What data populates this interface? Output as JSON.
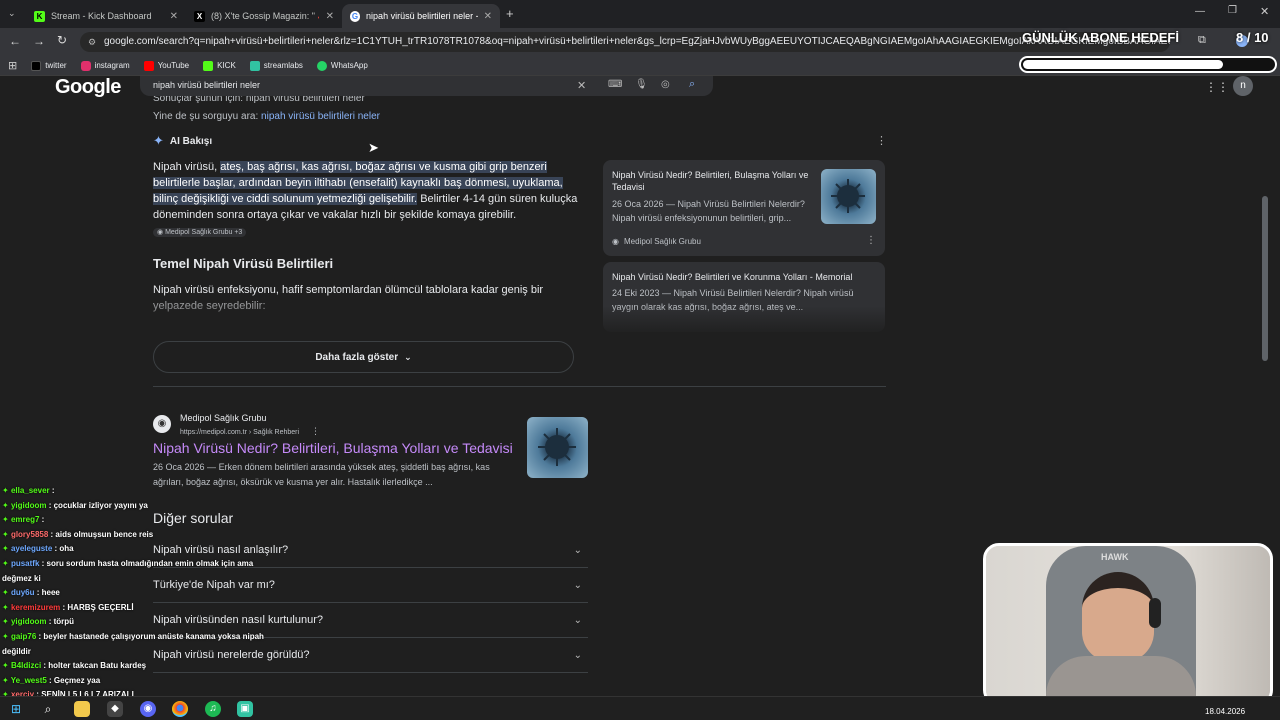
{
  "browser": {
    "tabs": [
      {
        "label": "Stream - Kick Dashboard"
      },
      {
        "label": "(8) X'te Gossip Magazin: \"🔺S"
      },
      {
        "label": "nipah virüsü belirtileri neler - G"
      }
    ],
    "url": "google.com/search?q=nipah+virüsü+belirtileri+neler&rlz=1C1YTUH_trTR1078TR1078&oq=nipah+virüsü+belirtileri+neler&gs_lcrp=EgZjaHJvbWUyBggAEEUYOTIJCAEQABgNGIAEMgoIAhAAGIAEGKIEMgoIAxAAGIAEGKIEMgoIBBAAGIAEGKIE",
    "bookmarks": [
      {
        "label": "twitter",
        "color": "#000000"
      },
      {
        "label": "instagram",
        "color": "#e1306c"
      },
      {
        "label": "YouTube",
        "color": "#ff0000"
      },
      {
        "label": "KICK",
        "color": "#53fc18"
      },
      {
        "label": "streamlabs",
        "color": "#31c3a2"
      },
      {
        "label": "WhatsApp",
        "color": "#25d366"
      }
    ]
  },
  "overlay": {
    "goal_label": "GÜNLÜK ABONE HEDEFİ",
    "goal_count": "8 / 10",
    "goal_progress": 0.8
  },
  "search": {
    "logo": "Google",
    "query": "nipah virüsü belirtileri neler",
    "related_cut": "Sonuçlar şunun için: nipah virüsü belirtileri neler",
    "search_instead_prefix": "Yine de şu sorguyu ara:",
    "search_instead_link": "nipah virüsü belirtileri neler"
  },
  "ai_overview": {
    "label": "AI Bakışı",
    "para_prefix": "Nipah virüsü,",
    "para_highlight": "ateş, baş ağrısı, kas ağrısı, boğaz ağrısı ve kusma gibi grip benzeri belirtilerle başlar, ardından beyin iltihabı (ensefalit) kaynaklı baş dönmesi, uyuklama, bilinç değişikliği ve ciddi solunum yetmezliği gelişebilir.",
    "para_rest": "Belirtiler 4-14 gün süren kuluçka döneminden sonra ortaya çıkar ve vakalar hızlı bir şekilde komaya girebilir.",
    "source_chip": "Medipol Sağlık Grubu +3",
    "heading": "Temel Nipah Virüsü Belirtileri",
    "heading_text": "Nipah virüsü enfeksiyonu, hafif semptomlardan ölümcül tablolara kadar geniş bir yelpazede seyredebilir:",
    "more_button": "Daha fazla göster",
    "sources": [
      {
        "title": "Nipah Virüsü Nedir? Belirtileri, Bulaşma Yolları ve Tedavisi",
        "snippet": "26 Oca 2026 — Nipah Virüsü Belirtileri Nelerdir? Nipah virüsü enfeksiyonunun belirtileri, grip...",
        "site": "Medipol Sağlık Grubu"
      },
      {
        "title": "Nipah Virüsü Nedir? Belirtileri ve Korunma Yolları - Memorial",
        "snippet": "24 Eki 2023 — Nipah Virüsü Belirtileri Nelerdir? Nipah virüsü yaygın olarak kas ağrısı, boğaz ağrısı, ateş ve..."
      }
    ]
  },
  "result": {
    "site": "Medipol Sağlık Grubu",
    "url": "https://medipol.com.tr › Sağlık Rehberi",
    "title": "Nipah Virüsü Nedir? Belirtileri, Bulaşma Yolları ve Tedavisi",
    "snippet_date": "26 Oca 2026 —",
    "snippet": "Erken dönem belirtileri arasında yüksek ateş, şiddetli baş ağrısı, kas ağrıları, boğaz ağrısı, öksürük ve kusma yer alır. Hastalık ilerledikçe ..."
  },
  "paa": {
    "heading": "Diğer sorular",
    "questions": [
      "Nipah virüsü nasıl anlaşılır?",
      "Türkiye'de Nipah var mı?",
      "Nipah virüsünden nasıl kurtulunur?",
      "Nipah virüsü nerelerde görüldü?"
    ]
  },
  "chat": [
    {
      "user": "ella_sever",
      "msg": ":",
      "color": "#53fc18"
    },
    {
      "user": "yigidoom",
      "msg": ": çocuklar izliyor yayını ya",
      "color": "#53fc18"
    },
    {
      "user": "emreg7",
      "msg": ":",
      "color": "#53fc18"
    },
    {
      "user": "glory5858",
      "msg": ": aids olmuşsun bence reis",
      "color": "#ff6b6b"
    },
    {
      "user": "ayeleguste",
      "msg": ": oha",
      "color": "#6ea8fe"
    },
    {
      "user": "pusatfk",
      "msg": ": soru sordum hasta olmadığından emin olmak için ama",
      "color": "#6ea8fe"
    },
    {
      "user": "",
      "msg": "değmez ki",
      "color": "#ffffff"
    },
    {
      "user": "duy6u",
      "msg": ": heee",
      "color": "#6ea8fe"
    },
    {
      "user": "keremizurem",
      "msg": ": HARBŞ GEÇERLİ",
      "color": "#ff3b3b"
    },
    {
      "user": "yigidoom",
      "msg": ": törpü",
      "color": "#53fc18"
    },
    {
      "user": "gaip76",
      "msg": ": beyler hastanede çalışıyorum anüste kanama yoksa nipah",
      "color": "#53fc18"
    },
    {
      "user": "",
      "msg": "değildir",
      "color": "#ffffff"
    },
    {
      "user": "B4ldizci",
      "msg": ": holter takcan Batu kardeş",
      "color": "#53fc18"
    },
    {
      "user": "Ye_west5",
      "msg": ": Geçmez yaa",
      "color": "#53fc18"
    },
    {
      "user": "xerciy",
      "msg": ": SENİN L5 L6 L7 ARIZALI",
      "color": "#ff6b6b"
    }
  ],
  "webcam": {
    "brand": "HAWK"
  },
  "taskbar": {
    "date": "18.04.2026"
  },
  "icons": [
    "search-icon",
    "close-icon",
    "keyboard-icon",
    "mic-icon",
    "lens-icon",
    "sparkle-icon",
    "chevron-down-icon",
    "more-vert-icon",
    "apps-icon",
    "back-icon",
    "forward-icon",
    "reload-icon",
    "windows-start-icon"
  ]
}
